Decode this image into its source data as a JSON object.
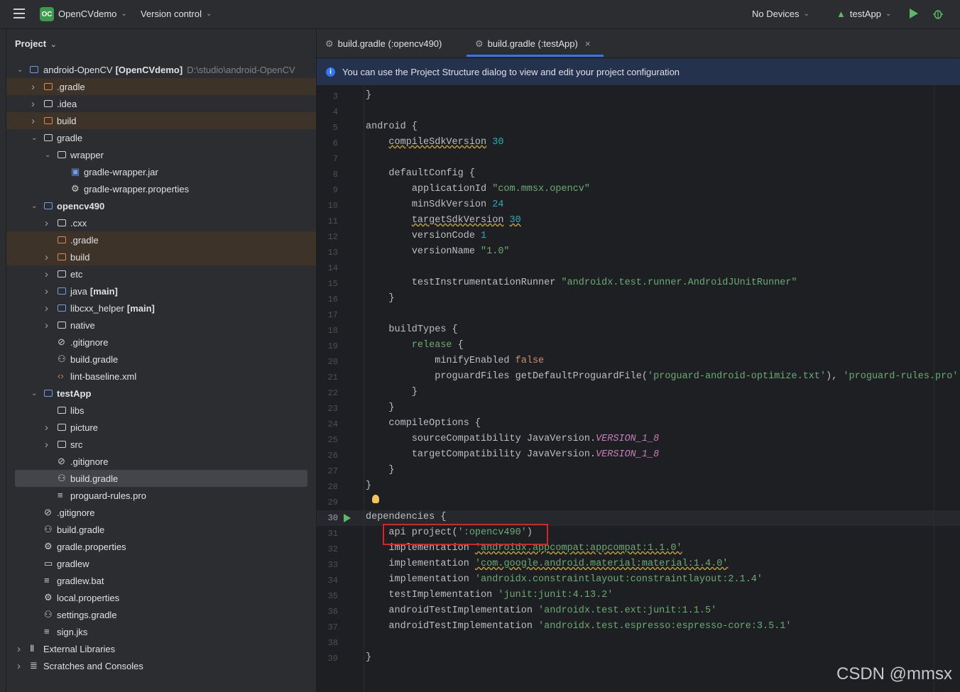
{
  "toolbar": {
    "project_badge": "OC",
    "project_name": "OpenCVdemo",
    "version_control": "Version control",
    "devices": "No Devices",
    "run_config": "testApp"
  },
  "panel": {
    "title": "Project"
  },
  "tree": [
    {
      "label": "android-OpenCV",
      "suffix": "[OpenCVdemo]",
      "path": "D:\\studio\\android-OpenCV"
    },
    {
      "label": ".gradle"
    },
    {
      "label": ".idea"
    },
    {
      "label": "build"
    },
    {
      "label": "gradle"
    },
    {
      "label": "wrapper"
    },
    {
      "label": "gradle-wrapper.jar"
    },
    {
      "label": "gradle-wrapper.properties"
    },
    {
      "label": "opencv490"
    },
    {
      "label": ".cxx"
    },
    {
      "label": ".gradle"
    },
    {
      "label": "build"
    },
    {
      "label": "etc"
    },
    {
      "label": "java",
      "suffix": "[main]"
    },
    {
      "label": "libcxx_helper",
      "suffix": "[main]"
    },
    {
      "label": "native"
    },
    {
      "label": ".gitignore"
    },
    {
      "label": "build.gradle"
    },
    {
      "label": "lint-baseline.xml"
    },
    {
      "label": "testApp"
    },
    {
      "label": "libs"
    },
    {
      "label": "picture"
    },
    {
      "label": "src"
    },
    {
      "label": ".gitignore"
    },
    {
      "label": "build.gradle"
    },
    {
      "label": "proguard-rules.pro"
    },
    {
      "label": ".gitignore"
    },
    {
      "label": "build.gradle"
    },
    {
      "label": "gradle.properties"
    },
    {
      "label": "gradlew"
    },
    {
      "label": "gradlew.bat"
    },
    {
      "label": "local.properties"
    },
    {
      "label": "settings.gradle"
    },
    {
      "label": "sign.jks"
    },
    {
      "label": "External Libraries"
    },
    {
      "label": "Scratches and Consoles"
    }
  ],
  "tabs": [
    {
      "label": "build.gradle (:opencv490)"
    },
    {
      "label": "build.gradle (:testApp)"
    }
  ],
  "banner": "You can use the Project Structure dialog to view and edit your project configuration",
  "line_numbers": [
    "3",
    "4",
    "5",
    "6",
    "7",
    "8",
    "9",
    "10",
    "11",
    "12",
    "13",
    "14",
    "15",
    "16",
    "17",
    "18",
    "19",
    "20",
    "21",
    "22",
    "23",
    "24",
    "25",
    "26",
    "27",
    "28",
    "29",
    "30",
    "31",
    "32",
    "33",
    "34",
    "35",
    "36",
    "37",
    "38",
    "39"
  ],
  "code": {
    "l3": "}",
    "l5": "android {",
    "l6a": "compileSdkVersion",
    "l6b": "30",
    "l8": "defaultConfig {",
    "l9a": "applicationId ",
    "l9b": "\"com.mmsx.opencv\"",
    "l10a": "minSdkVersion ",
    "l10b": "24",
    "l11a": "targetSdkVersion",
    "l11b": "30",
    "l12a": "versionCode ",
    "l12b": "1",
    "l13a": "versionName ",
    "l13b": "\"1.0\"",
    "l15a": "testInstrumentationRunner ",
    "l15b": "\"androidx.test.runner.AndroidJUnitRunner\"",
    "l16": "}",
    "l18": "buildTypes {",
    "l19a": "release",
    "l19b": " {",
    "l20a": "minifyEnabled ",
    "l20b": "false",
    "l21a": "proguardFiles getDefaultProguardFile(",
    "l21b": "'proguard-android-optimize.txt'",
    "l21c": "), ",
    "l21d": "'proguard-rules.pro'",
    "l22": "}",
    "l23": "}",
    "l24": "compileOptions {",
    "l25a": "sourceCompatibility JavaVersion.",
    "l25b": "VERSION_1_8",
    "l26a": "targetCompatibility JavaVersion.",
    "l26b": "VERSION_1_8",
    "l27": "}",
    "l28": "}",
    "l30": "dependencies {",
    "l31a": "api project(",
    "l31b": "':opencv490'",
    "l31c": ")",
    "l32a": "implementation ",
    "l32b": "'androidx.appcompat:appcompat:1.1.0'",
    "l33a": "implementation ",
    "l33b": "'com.google.android.material:material:1.4.0'",
    "l34a": "implementation ",
    "l34b": "'androidx.constraintlayout:constraintlayout:2.1.4'",
    "l35a": "testImplementation ",
    "l35b": "'junit:junit:4.13.2'",
    "l36a": "androidTestImplementation ",
    "l36b": "'androidx.test.ext:junit:1.1.5'",
    "l37a": "androidTestImplementation ",
    "l37b": "'androidx.test.espresso:espresso-core:3.5.1'",
    "l39": "}"
  },
  "watermark": "CSDN @mmsx",
  "colors": {
    "accent": "#3574f0",
    "highlight_box": "#e02020",
    "run_green": "#5fb865"
  }
}
